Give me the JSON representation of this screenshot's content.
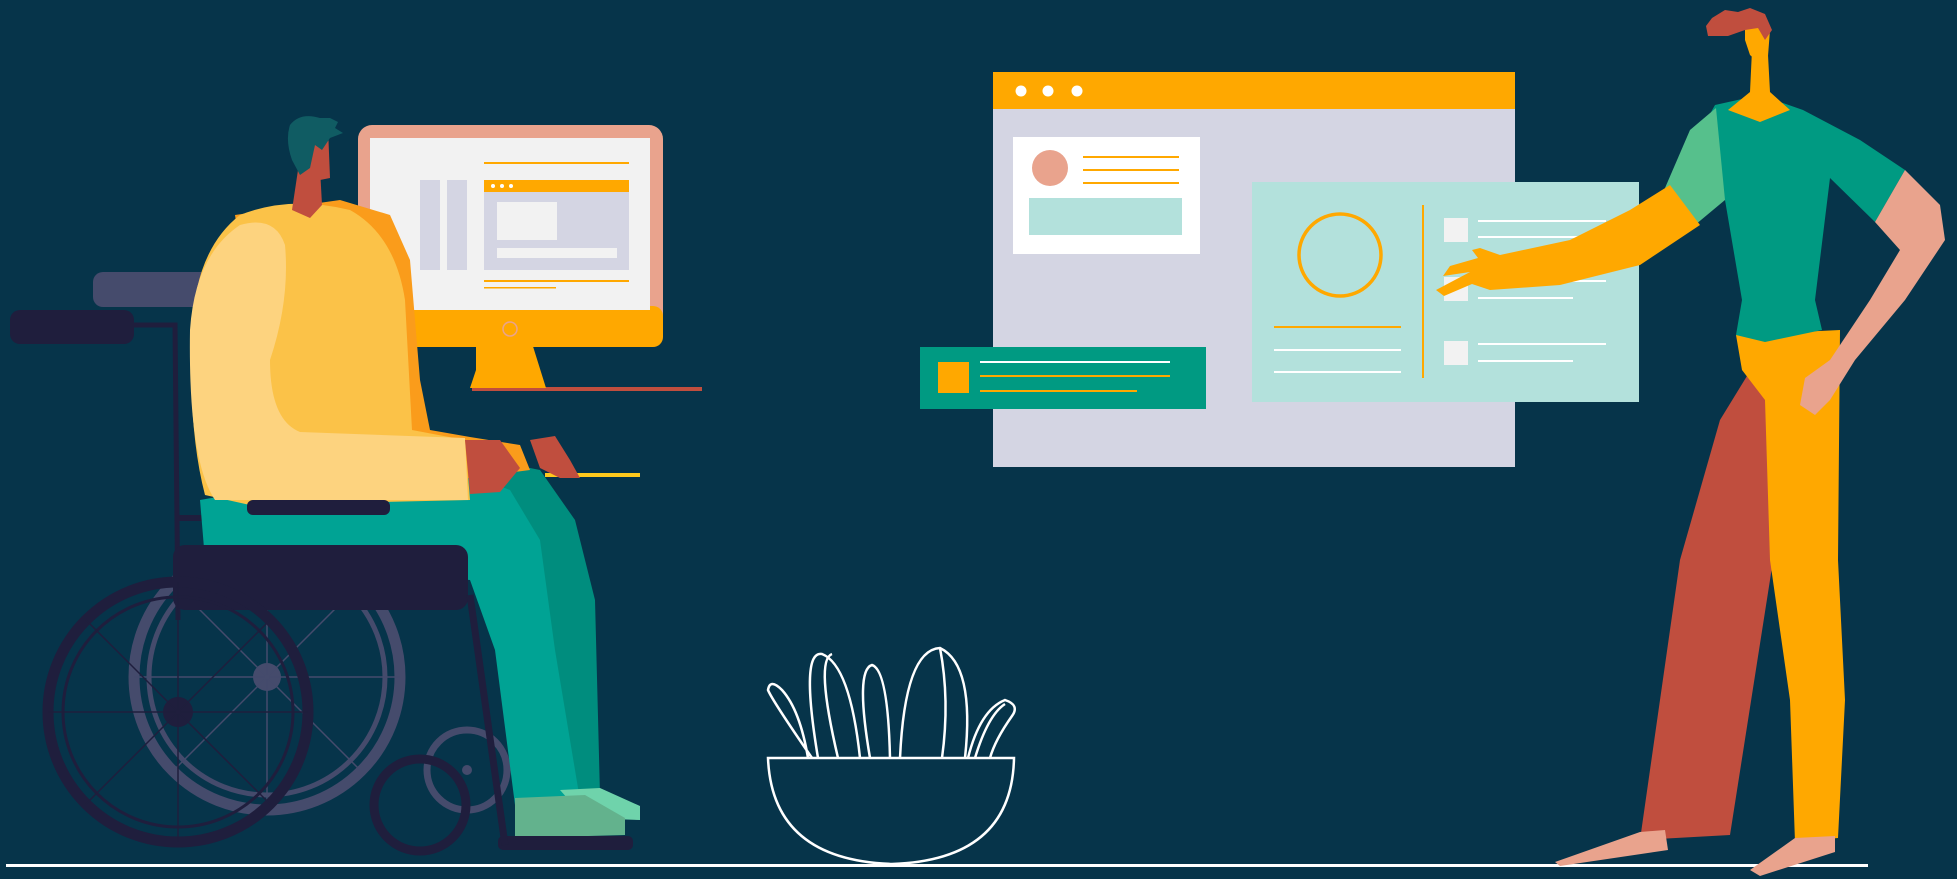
{
  "scene": {
    "description_free": true,
    "colors": {
      "background": "#06344a",
      "accent_orange": "#ffa800",
      "teal": "#009a82",
      "mint": "#b3e1dc",
      "lavender": "#d4d5e3",
      "skin_peach": "#e9a38d",
      "brick": "#c04e3e",
      "navy": "#1f1e3d",
      "yellow_light": "#fdd37f",
      "yellow_mid": "#fbc248",
      "white": "#ffffff",
      "wheel_gray": "#454b6c",
      "plant_stroke": "#ffffff"
    },
    "icons": {
      "browser_dots": "three-dots-icon",
      "avatar": "avatar-circle-icon",
      "ring": "ring-chart-icon",
      "checkbox": "checkbox-icon",
      "plant": "plant-pot-icon"
    }
  }
}
